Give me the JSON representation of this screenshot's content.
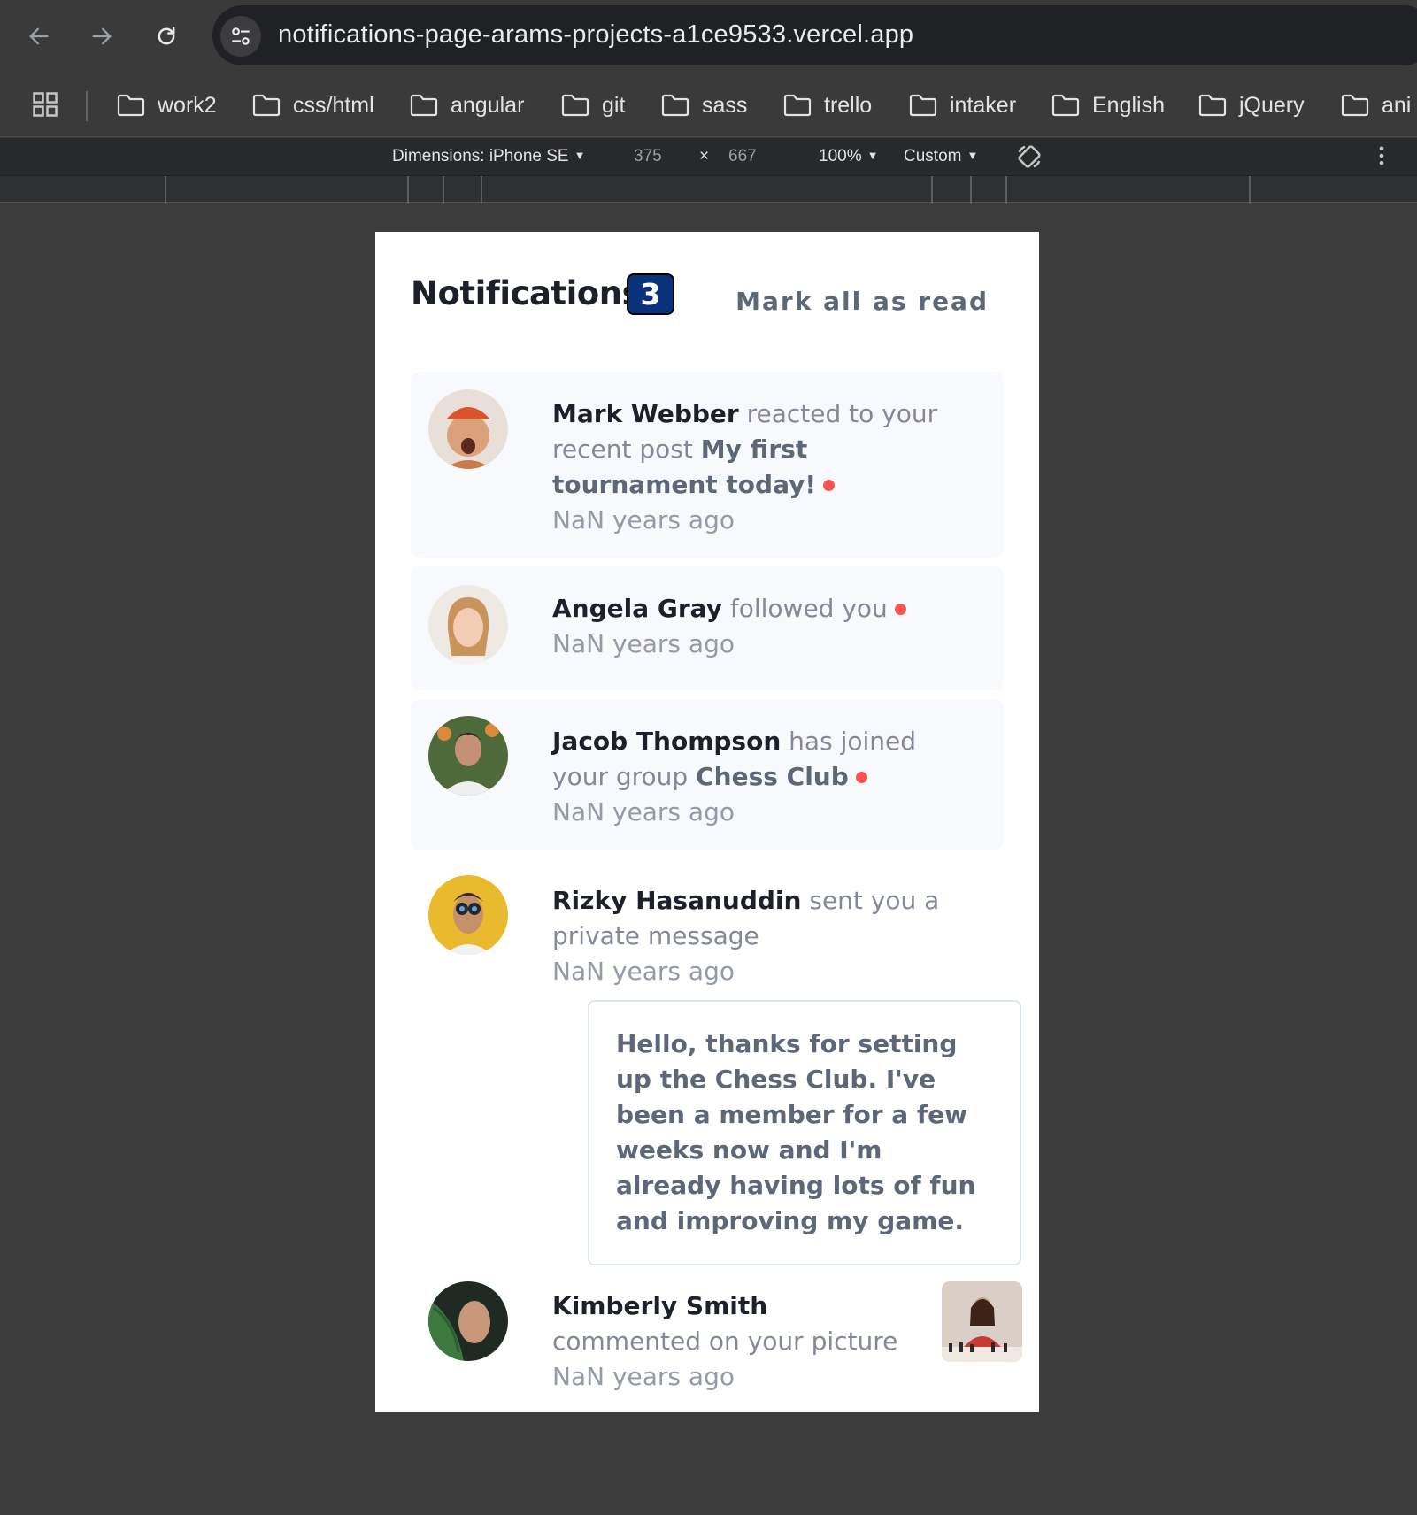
{
  "browser": {
    "url": "notifications-page-arams-projects-a1ce9533.vercel.app",
    "bookmarks": [
      "work2",
      "css/html",
      "angular",
      "git",
      "sass",
      "trello",
      "intaker",
      "English",
      "jQuery",
      "ani"
    ]
  },
  "devtools": {
    "dimensions_label": "Dimensions: iPhone SE",
    "width": "375",
    "times": "×",
    "height": "667",
    "zoom": "100%",
    "throttle": "Custom"
  },
  "page": {
    "title": "Notifications",
    "unread_count": "3",
    "mark_all_label": "Mark all as read",
    "notifications": [
      {
        "name": "Mark Webber",
        "action": "reacted to your recent post",
        "target": "My first tournament today!",
        "time": "NaN years ago",
        "unread": true
      },
      {
        "name": "Angela Gray",
        "action": "followed you",
        "target": "",
        "time": "NaN years ago",
        "unread": true
      },
      {
        "name": "Jacob Thompson",
        "action": "has joined your group",
        "target": "Chess Club",
        "time": "NaN years ago",
        "unread": true
      },
      {
        "name": "Rizky Hasanuddin",
        "action": "sent you a private message",
        "target": "",
        "time": "NaN years ago",
        "unread": false,
        "message": "Hello, thanks for setting up the Chess Club. I've been a member for a few weeks now and I'm already having lots of fun and improving my game."
      },
      {
        "name": "Kimberly Smith",
        "action": "commented on your picture",
        "target": "",
        "time": "NaN years ago",
        "unread": false
      }
    ]
  },
  "colors": {
    "badge": "#0a327b",
    "unread_bg": "#f7f9fd",
    "dot": "#f65552"
  }
}
